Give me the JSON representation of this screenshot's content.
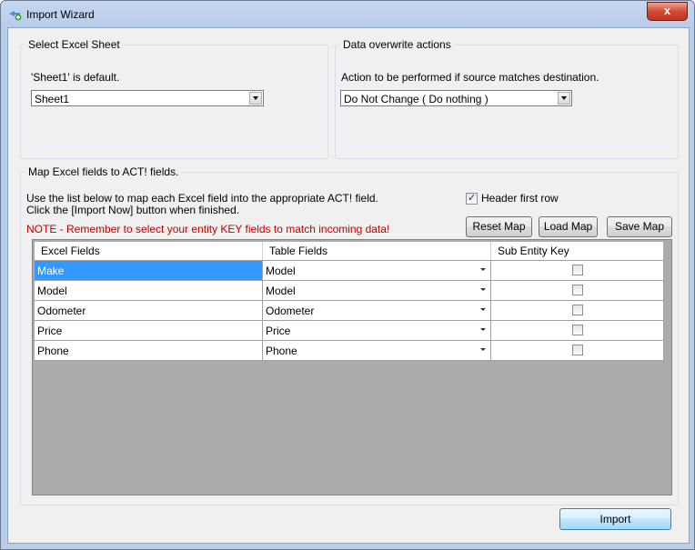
{
  "window": {
    "title": "Import Wizard",
    "close_label": "x"
  },
  "sheet_group": {
    "legend": "Select Excel Sheet",
    "hint": "'Sheet1' is default.",
    "selected": "Sheet1"
  },
  "overwrite_group": {
    "legend": "Data overwrite actions",
    "hint": "Action to be performed if source matches destination.",
    "selected": "Do Not Change ( Do nothing )"
  },
  "map_group": {
    "legend": "Map Excel fields to ACT! fields.",
    "instruction_1": "Use the list below to map each Excel field into the appropriate ACT! field.",
    "instruction_2": "Click the [Import Now] button when finished.",
    "note": "NOTE - Remember to select your entity KEY fields to match incoming data!",
    "header_first_row_label": "Header first row",
    "header_first_row_checked": true,
    "buttons": {
      "reset": "Reset Map",
      "load": "Load Map",
      "save": "Save Map"
    }
  },
  "grid": {
    "columns": [
      "Excel Fields",
      "Table Fields",
      "Sub Entity Key"
    ],
    "rows": [
      {
        "excel": "Make",
        "table": "Model",
        "key": false
      },
      {
        "excel": "Model",
        "table": "Model",
        "key": false
      },
      {
        "excel": "Odometer",
        "table": "Odometer",
        "key": false
      },
      {
        "excel": "Price",
        "table": "Price",
        "key": false
      },
      {
        "excel": "Phone",
        "table": "Phone",
        "key": false
      }
    ]
  },
  "footer": {
    "import_label": "Import"
  },
  "colors": {
    "note": "#c00000",
    "selection": "#3399ff"
  }
}
